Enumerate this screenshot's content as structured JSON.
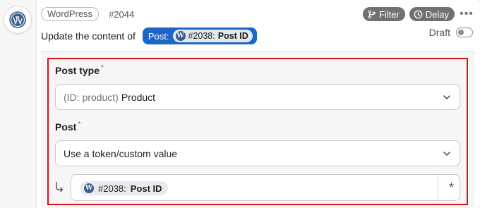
{
  "step": {
    "app_name": "WordPress",
    "step_id": "#2044",
    "filter_label": "Filter",
    "delay_label": "Delay",
    "more_label": "•••"
  },
  "description": {
    "text": "Update the content of",
    "token_prefix": "Post:",
    "token_id": "#2038:",
    "token_name": "Post ID"
  },
  "draft": {
    "label": "Draft",
    "enabled": false
  },
  "form": {
    "post_type": {
      "label": "Post type",
      "required_mark": "*",
      "value_prefix": "(ID: product)",
      "value": "Product"
    },
    "post": {
      "label": "Post",
      "required_mark": "*",
      "value": "Use a token/custom value"
    },
    "token_field": {
      "chip_id": "#2038:",
      "chip_name": "Post ID",
      "custom_symbol": "*"
    }
  },
  "colors": {
    "accent": "#1c66c7",
    "highlight_border": "#e0101b",
    "pill_bg": "#707075",
    "required": "#d63638"
  },
  "icons": [
    "wordpress-icon",
    "filter-icon",
    "clock-icon",
    "more-icon",
    "chevron-down-icon",
    "link-icon",
    "asterisk-icon"
  ]
}
